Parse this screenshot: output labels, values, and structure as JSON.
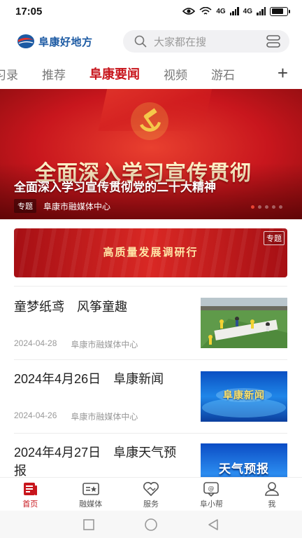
{
  "status_bar": {
    "time": "17:05",
    "network_1": "4G",
    "network_2": "4G",
    "wifi_badge": "6"
  },
  "header": {
    "logo_text": "阜康好地方",
    "search_placeholder": "大家都在搜"
  },
  "tabs": [
    {
      "label": "习录"
    },
    {
      "label": "推荐"
    },
    {
      "label": "阜康要闻",
      "active": true
    },
    {
      "label": "视频"
    },
    {
      "label": "游石"
    }
  ],
  "banner": {
    "big_text": "全面深入学习宣传贯彻",
    "title": "全面深入学习宣传贯彻党的二十大精神",
    "tag": "专题",
    "source": "阜康市融媒体中心",
    "slide_count": 5,
    "active_slide": 0
  },
  "topic_strip": {
    "title": "高质量发展调研行",
    "tag": "专题"
  },
  "news": [
    {
      "title": "童梦纸鸢　风筝童趣",
      "date": "2024-04-28",
      "source": "阜康市融媒体中心",
      "thumb_text": ""
    },
    {
      "title": "2024年4月26日　阜康新闻",
      "date": "2024-04-26",
      "source": "阜康市融媒体中心",
      "thumb_text": "阜康新闻"
    },
    {
      "title": "2024年4月27日　阜康天气预报",
      "date": "",
      "source": "",
      "thumb_text": "天气预报"
    }
  ],
  "bottom_nav": [
    {
      "label": "首页",
      "icon": "home-news-icon",
      "active": true
    },
    {
      "label": "融媒体",
      "icon": "media-icon"
    },
    {
      "label": "服务",
      "icon": "service-icon"
    },
    {
      "label": "阜小帮",
      "icon": "helper-chat-icon"
    },
    {
      "label": "我",
      "icon": "profile-icon"
    }
  ],
  "colors": {
    "brand_red": "#c8161d",
    "brand_blue": "#1c5aa3"
  }
}
